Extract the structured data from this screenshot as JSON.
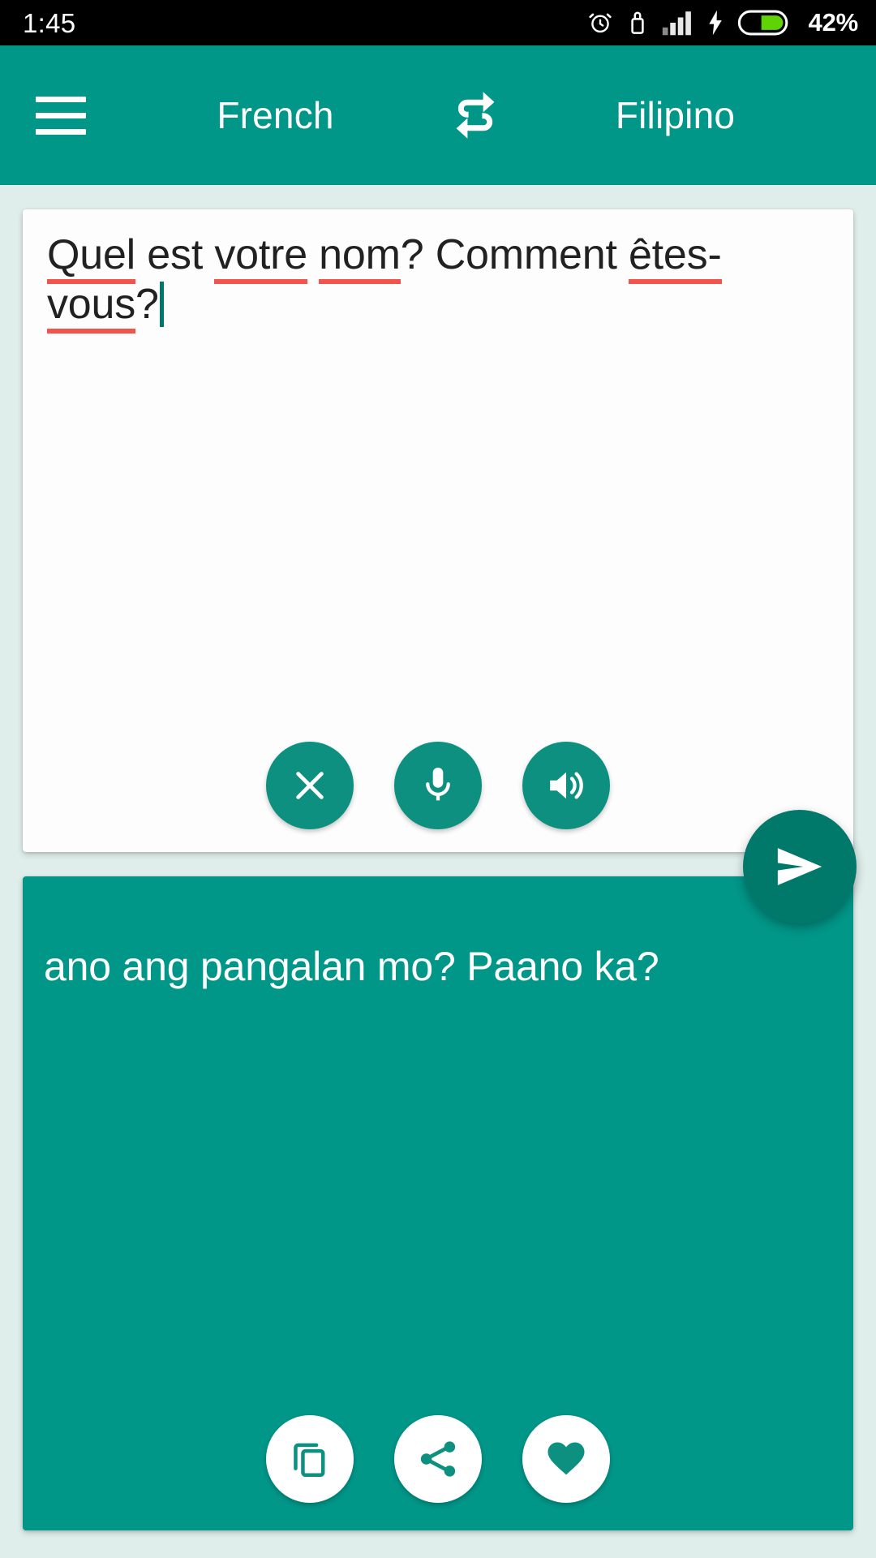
{
  "status_bar": {
    "time": "1:45",
    "battery_percent": "42%",
    "icons": [
      "alarm-icon",
      "usb-icon",
      "signal-icon",
      "charging-bolt-icon",
      "battery-icon"
    ],
    "background_color": "#000000",
    "text_color": "#ffffff"
  },
  "toolbar": {
    "menu_icon": "hamburger-menu-icon",
    "source_language": "French",
    "swap_icon": "swap-languages-icon",
    "target_language": "Filipino",
    "background_color": "#009688",
    "text_color": "#ffffff"
  },
  "source_panel": {
    "text_parts": [
      {
        "text": "Quel",
        "misspelled": true
      },
      {
        "text": " est ",
        "misspelled": false
      },
      {
        "text": "votre",
        "misspelled": true
      },
      {
        "text": " ",
        "misspelled": false
      },
      {
        "text": "nom",
        "misspelled": true
      },
      {
        "text": "? Comment ",
        "misspelled": false
      },
      {
        "text": "êtes-",
        "misspelled": true
      },
      {
        "text": "vous",
        "misspelled": true
      },
      {
        "text": "?",
        "misspelled": false
      }
    ],
    "full_text": "Quel est votre nom? Comment êtes-vous?",
    "has_caret": true,
    "caret_color": "#00796b",
    "spellcheck_underline_color": "#f2544c",
    "background_color": "#fdfdfd",
    "text_color": "#212121",
    "actions": [
      {
        "name": "clear-button",
        "icon": "close-x-icon",
        "label": "Clear"
      },
      {
        "name": "voice-input-button",
        "icon": "microphone-icon",
        "label": "Voice input"
      },
      {
        "name": "speak-source-button",
        "icon": "speaker-volume-icon",
        "label": "Listen"
      }
    ]
  },
  "send_button": {
    "icon": "send-arrow-icon",
    "label": "Translate",
    "color": "#00796b"
  },
  "target_panel": {
    "text": "ano ang pangalan mo? Paano ka?",
    "background_color": "#009688",
    "text_color": "#ffffff",
    "actions": [
      {
        "name": "copy-button",
        "icon": "copy-icon",
        "label": "Copy"
      },
      {
        "name": "share-button",
        "icon": "share-icon",
        "label": "Share"
      },
      {
        "name": "favorite-button",
        "icon": "heart-icon",
        "label": "Favorite"
      }
    ]
  },
  "page_background_color": "#dfeeeb"
}
